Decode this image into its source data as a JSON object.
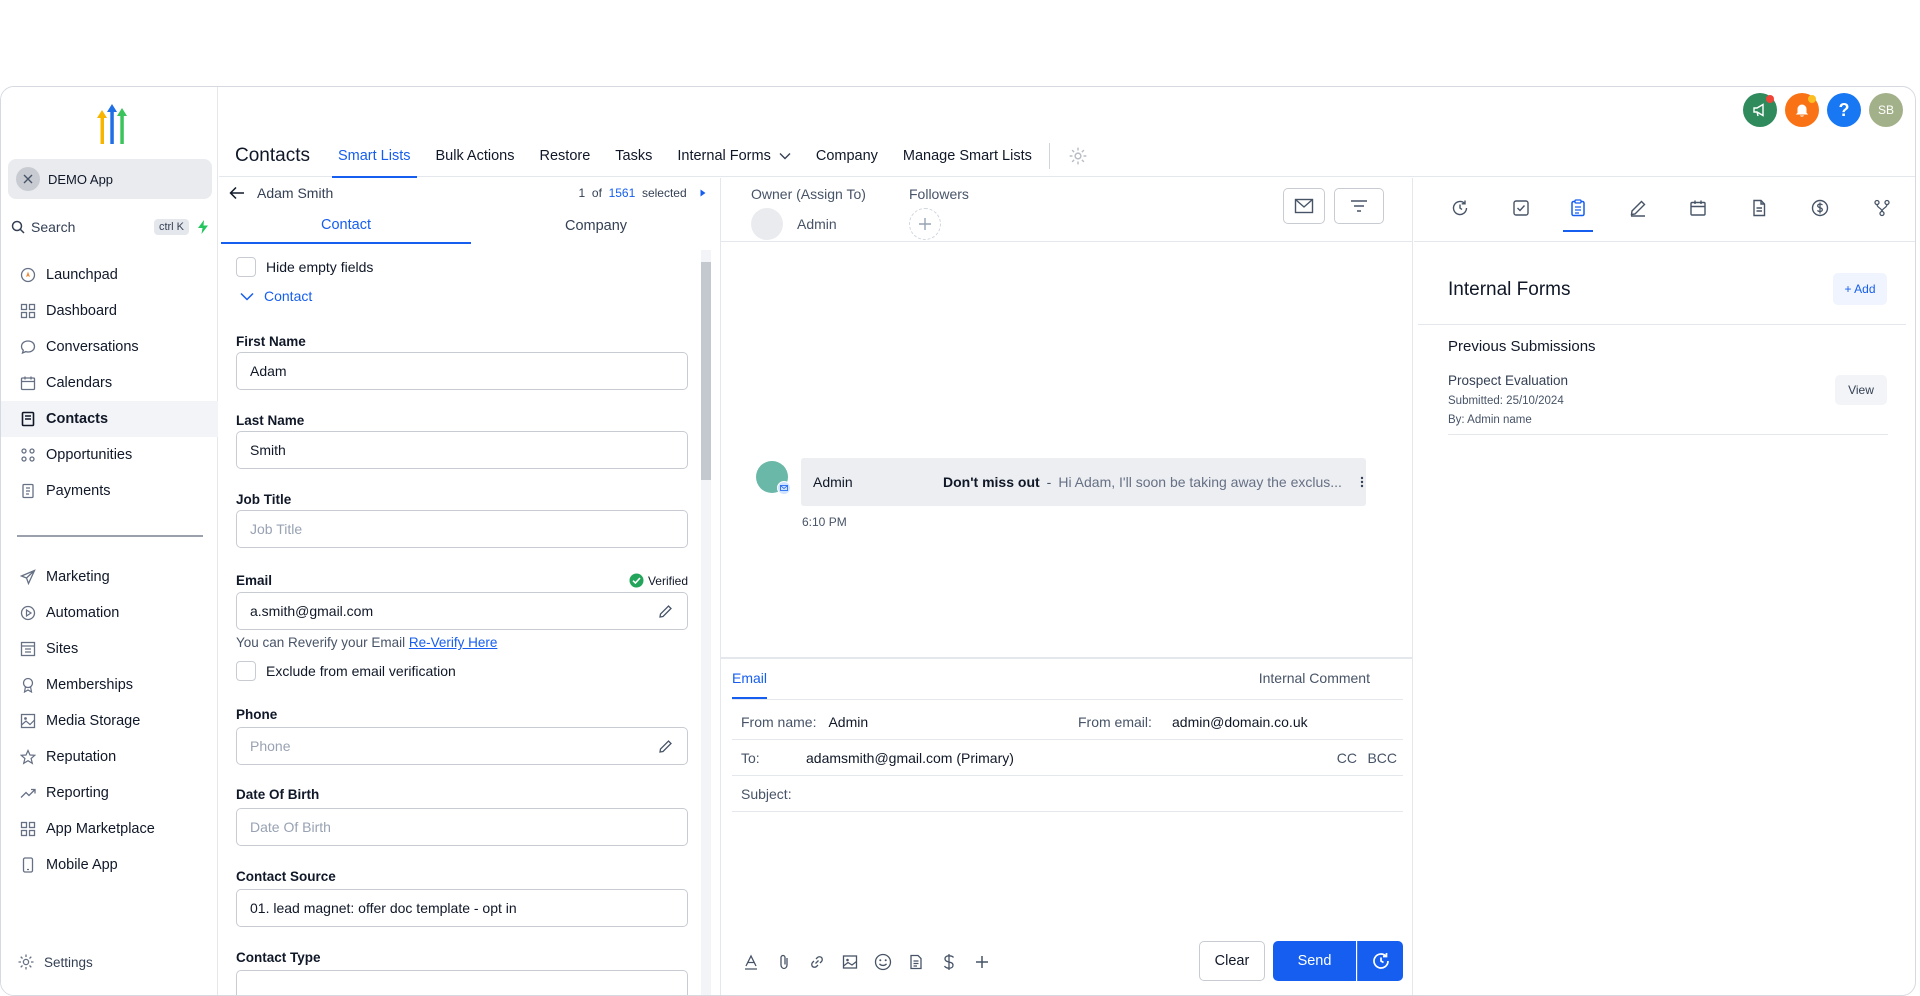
{
  "sidebar": {
    "account_name": "DEMO App",
    "search_label": "Search",
    "search_shortcut": "ctrl K",
    "nav_primary": [
      {
        "label": "Launchpad",
        "icon": "launchpad-icon"
      },
      {
        "label": "Dashboard",
        "icon": "dashboard-icon"
      },
      {
        "label": "Conversations",
        "icon": "chat-icon"
      },
      {
        "label": "Calendars",
        "icon": "calendar-icon"
      },
      {
        "label": "Contacts",
        "icon": "contacts-icon",
        "active": true
      },
      {
        "label": "Opportunities",
        "icon": "opportunities-icon"
      },
      {
        "label": "Payments",
        "icon": "payments-icon"
      }
    ],
    "nav_secondary": [
      {
        "label": "Marketing",
        "icon": "send-icon"
      },
      {
        "label": "Automation",
        "icon": "automation-icon"
      },
      {
        "label": "Sites",
        "icon": "sites-icon"
      },
      {
        "label": "Memberships",
        "icon": "memberships-icon"
      },
      {
        "label": "Media Storage",
        "icon": "image-icon"
      },
      {
        "label": "Reputation",
        "icon": "star-icon"
      },
      {
        "label": "Reporting",
        "icon": "trend-icon"
      },
      {
        "label": "App Marketplace",
        "icon": "grid-icon"
      },
      {
        "label": "Mobile App",
        "icon": "mobile-icon"
      }
    ],
    "settings_label": "Settings"
  },
  "topbar": {
    "title": "Contacts",
    "tabs": [
      {
        "label": "Smart Lists",
        "active": true
      },
      {
        "label": "Bulk Actions"
      },
      {
        "label": "Restore"
      },
      {
        "label": "Tasks"
      },
      {
        "label": "Internal Forms",
        "has_dropdown": true
      },
      {
        "label": "Company"
      },
      {
        "label": "Manage Smart Lists"
      }
    ],
    "user_initials": "SB",
    "help_symbol": "?"
  },
  "contact": {
    "name": "Adam Smith",
    "pager_position": "1",
    "pager_of": "of",
    "pager_total": "1561",
    "pager_selected": "selected",
    "tabs": [
      "Contact",
      "Company"
    ],
    "hide_empty_label": "Hide empty fields",
    "section_label": "Contact",
    "first_name_label": "First Name",
    "first_name": "Adam",
    "last_name_label": "Last Name",
    "last_name": "Smith",
    "job_title_label": "Job Title",
    "job_title_placeholder": "Job Title",
    "email_label": "Email",
    "email_verified": "Verified",
    "email": "a.smith@gmail.com",
    "reverify_text": "You can Reverify your Email",
    "reverify_link": "Re-Verify Here",
    "exclude_label": "Exclude from email verification",
    "phone_label": "Phone",
    "phone_placeholder": "Phone",
    "dob_label": "Date Of Birth",
    "dob_placeholder": "Date Of Birth",
    "source_label": "Contact Source",
    "source": "01. lead magnet: offer doc template - opt in",
    "type_label": "Contact Type"
  },
  "conversation": {
    "owner_label": "Owner (Assign To)",
    "owner_name": "Admin",
    "followers_label": "Followers",
    "message": {
      "sender": "Admin",
      "subject": "Don't miss out",
      "separator": "-",
      "preview": "Hi Adam, I'll soon be taking away the exclus...",
      "time": "6:10 PM"
    },
    "composer": {
      "tab_email": "Email",
      "tab_internal": "Internal Comment",
      "from_name_label": "From name:",
      "from_name": "Admin",
      "from_email_label": "From email:",
      "from_email": "admin@domain.co.uk",
      "to_label": "To:",
      "to_value": "adamsmith@gmail.com (Primary)",
      "cc": "CC",
      "bcc": "BCC",
      "subject_label": "Subject:",
      "clear_label": "Clear",
      "send_label": "Send"
    }
  },
  "right_panel": {
    "title": "Internal Forms",
    "add_label": "+ Add",
    "section_title": "Previous Submissions",
    "submission": {
      "name": "Prospect Evaluation",
      "submitted": "Submitted: 25/10/2024",
      "by": "By: Admin name",
      "view_label": "View"
    }
  },
  "colors": {
    "accent": "#155eef",
    "active_bg": "#f2f4f7"
  }
}
